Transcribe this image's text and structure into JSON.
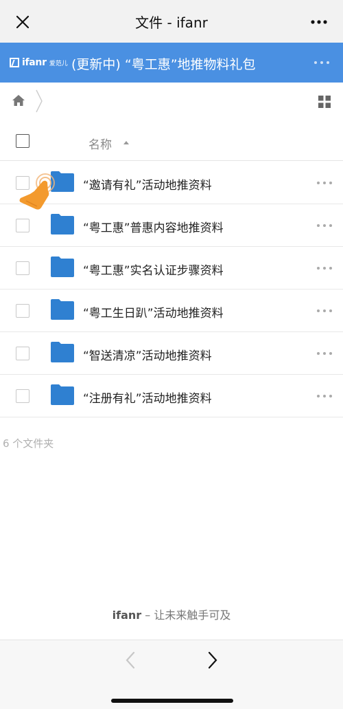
{
  "nav": {
    "title": "文件 - ifanr",
    "close_icon": "close-icon",
    "more_icon": "more-icon"
  },
  "banner": {
    "brand_name": "ifanr",
    "brand_cn": "爱范儿",
    "title": "(更新中) “粤工惠”地推物料礼包",
    "color": "#4a90e2"
  },
  "list": {
    "header_label": "名称",
    "items": [
      {
        "name": "“邀请有礼”活动地推资料"
      },
      {
        "name": "“粤工惠”普惠内容地推资料"
      },
      {
        "name": "“粤工惠”实名认证步骤资料"
      },
      {
        "name": "“粤工生日趴”活动地推资料"
      },
      {
        "name": "“智送清凉”活动地推资料"
      },
      {
        "name": "“注册有礼”活动地推资料"
      }
    ],
    "count_text": "6 个文件夹"
  },
  "footer": {
    "slogan_brand": "ifanr",
    "slogan_text": " – 让未来触手可及"
  },
  "colors": {
    "folder": "#2f80d1",
    "accent": "#4a90e2"
  }
}
